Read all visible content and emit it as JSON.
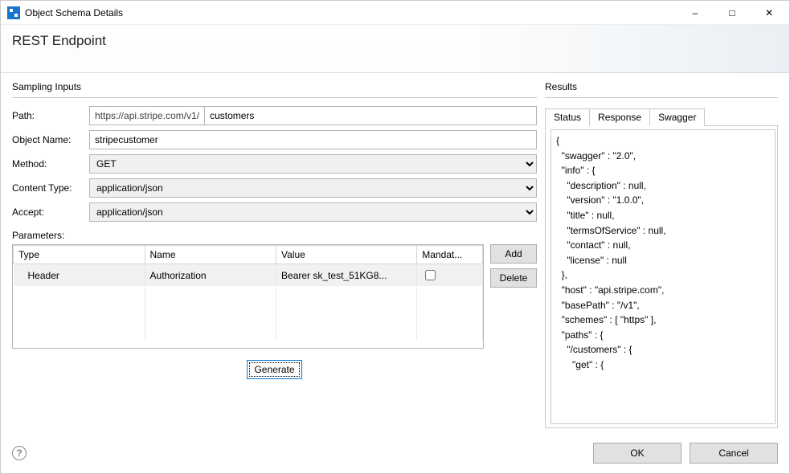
{
  "window": {
    "title": "Object Schema Details",
    "heading": "REST Endpoint"
  },
  "sampling": {
    "group_label": "Sampling Inputs",
    "path_label": "Path:",
    "path_prefix": "https://api.stripe.com/v1/",
    "path_value": "customers",
    "object_name_label": "Object Name:",
    "object_name_value": "stripecustomer",
    "method_label": "Method:",
    "method_value": "GET",
    "content_type_label": "Content Type:",
    "content_type_value": "application/json",
    "accept_label": "Accept:",
    "accept_value": "application/json",
    "parameters_label": "Parameters:"
  },
  "params_table": {
    "headers": {
      "type": "Type",
      "name": "Name",
      "value": "Value",
      "mandatory": "Mandat..."
    },
    "row0": {
      "type": "Header",
      "name": "Authorization",
      "value": "Bearer sk_test_51KG8...",
      "mandatory": false
    }
  },
  "buttons": {
    "add": "Add",
    "delete": "Delete",
    "generate": "Generate",
    "ok": "OK",
    "cancel": "Cancel"
  },
  "results": {
    "group_label": "Results",
    "tabs": {
      "status": "Status",
      "response": "Response",
      "swagger": "Swagger"
    },
    "swagger_text": "{\n  \"swagger\" : \"2.0\",\n  \"info\" : {\n    \"description\" : null,\n    \"version\" : \"1.0.0\",\n    \"title\" : null,\n    \"termsOfService\" : null,\n    \"contact\" : null,\n    \"license\" : null\n  },\n  \"host\" : \"api.stripe.com\",\n  \"basePath\" : \"/v1\",\n  \"schemes\" : [ \"https\" ],\n  \"paths\" : {\n    \"/customers\" : {\n      \"get\" : {"
  }
}
